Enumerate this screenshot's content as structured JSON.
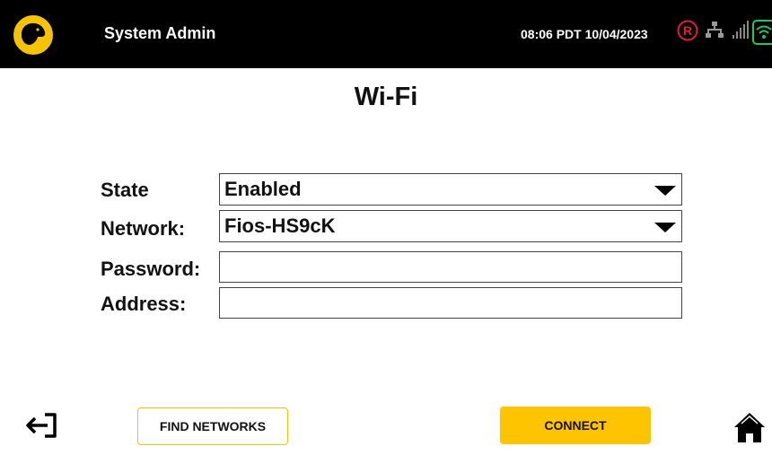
{
  "header": {
    "title": "System Admin",
    "datetime": "08:06 PDT 10/04/2023",
    "logo_icon": "dog-head-logo",
    "status_icons": [
      "registered-r-icon",
      "wired-network-icon",
      "signal-bars-icon",
      "wifi-icon"
    ]
  },
  "page": {
    "title": "Wi-Fi"
  },
  "form": {
    "state": {
      "label": "State",
      "value": "Enabled"
    },
    "network": {
      "label": "Network:",
      "value": "Fios-HS9cK"
    },
    "password": {
      "label": "Password:",
      "value": ""
    },
    "address": {
      "label": "Address:",
      "value": ""
    }
  },
  "footer": {
    "find_label": "FIND NETWORKS",
    "connect_label": "CONNECT",
    "logout_icon": "logout-arrow-icon",
    "home_icon": "home-icon"
  },
  "colors": {
    "header_bg": "#000000",
    "accent_yellow": "#ffc400",
    "status_red": "#e0202a",
    "wifi_green": "#22c55e"
  }
}
